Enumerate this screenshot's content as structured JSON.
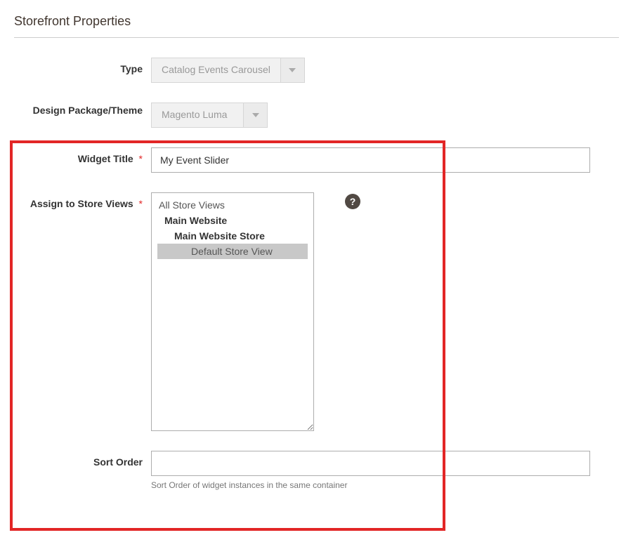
{
  "section": {
    "title": "Storefront Properties"
  },
  "fields": {
    "type": {
      "label": "Type",
      "value": "Catalog Events Carousel"
    },
    "theme": {
      "label": "Design Package/Theme",
      "value": "Magento Luma"
    },
    "widget_title": {
      "label": "Widget Title",
      "value": "My Event Slider",
      "required_mark": "*"
    },
    "store_views": {
      "label": "Assign to Store Views",
      "required_mark": "*",
      "options": {
        "all": "All Store Views",
        "main_website": "Main Website",
        "main_store": "Main Website Store",
        "default_view": "Default Store View"
      },
      "help": "?"
    },
    "sort_order": {
      "label": "Sort Order",
      "value": "",
      "note": "Sort Order of widget instances in the same container"
    }
  }
}
